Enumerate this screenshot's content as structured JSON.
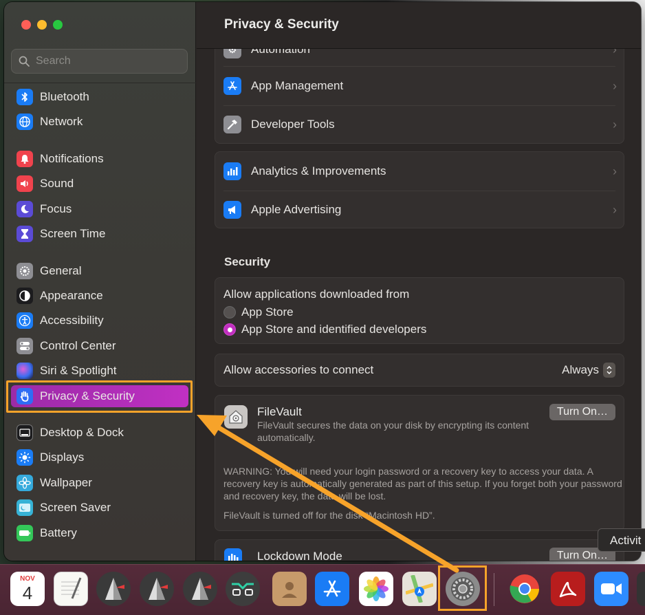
{
  "window": {
    "title": "Privacy & Security"
  },
  "search": {
    "placeholder": "Search"
  },
  "sidebar": {
    "items": [
      {
        "label": "Bluetooth",
        "icon": "bluetooth-icon",
        "color": "#1a7cf5"
      },
      {
        "label": "Network",
        "icon": "globe-icon",
        "color": "#1a7cf5"
      },
      {
        "label": "Notifications",
        "icon": "bell-icon",
        "color": "#f0434d"
      },
      {
        "label": "Sound",
        "icon": "speaker-icon",
        "color": "#f0434d"
      },
      {
        "label": "Focus",
        "icon": "moon-icon",
        "color": "#5b4bd6"
      },
      {
        "label": "Screen Time",
        "icon": "hourglass-icon",
        "color": "#5b4bd6"
      },
      {
        "label": "General",
        "icon": "gear-icon",
        "color": "#8e8e93"
      },
      {
        "label": "Appearance",
        "icon": "appearance-icon",
        "color": "#1c1c1e"
      },
      {
        "label": "Accessibility",
        "icon": "accessibility-icon",
        "color": "#1a7cf5"
      },
      {
        "label": "Control Center",
        "icon": "toggles-icon",
        "color": "#8e8e93"
      },
      {
        "label": "Siri & Spotlight",
        "icon": "siri-icon",
        "color": "#2c2c8c"
      },
      {
        "label": "Privacy & Security",
        "icon": "hand-icon",
        "color": "#2f6df5"
      },
      {
        "label": "Desktop & Dock",
        "icon": "dock-icon",
        "color": "#1c1c1e"
      },
      {
        "label": "Displays",
        "icon": "sun-icon",
        "color": "#1a7cf5"
      },
      {
        "label": "Wallpaper",
        "icon": "flower-icon",
        "color": "#35aadc"
      },
      {
        "label": "Screen Saver",
        "icon": "screensaver-icon",
        "color": "#37b3d6"
      },
      {
        "label": "Battery",
        "icon": "battery-icon",
        "color": "#34c759"
      }
    ]
  },
  "privacy": {
    "partial_row": "Automation",
    "group1": [
      {
        "label": "App Management",
        "icon": "appstore-icon",
        "color": "#1a7cf5"
      },
      {
        "label": "Developer Tools",
        "icon": "hammer-icon",
        "color": "#8e8e93"
      }
    ],
    "group2": [
      {
        "label": "Analytics & Improvements",
        "icon": "chart-icon",
        "color": "#1a7cf5"
      },
      {
        "label": "Apple Advertising",
        "icon": "megaphone-icon",
        "color": "#1a7cf5"
      }
    ]
  },
  "security": {
    "title": "Security",
    "allow_apps_label": "Allow applications downloaded from",
    "options": [
      "App Store",
      "App Store and identified developers"
    ],
    "selected_option": 1,
    "accessories_label": "Allow accessories to connect",
    "accessories_value": "Always",
    "filevault": {
      "title": "FileVault",
      "description": "FileVault secures the data on your disk by encrypting its content automatically.",
      "button": "Turn On…",
      "warning": "WARNING: You will need your login password or a recovery key to access your data. A recovery key is automatically generated as part of this setup. If you forget both your password and recovery key, the data will be lost.",
      "status": "FileVault is turned off for the disk “Macintosh HD”."
    },
    "lockdown": {
      "title": "Lockdown Mode",
      "button": "Turn On…"
    }
  },
  "tooltip": {
    "text": "Activit"
  },
  "dock": {
    "calendar_month": "NOV",
    "calendar_day": "4",
    "apps": [
      "calendar",
      "textedit",
      "grapher",
      "grapher",
      "grapher",
      "glasses-app",
      "contacts",
      "app-store",
      "photos",
      "maps",
      "system-settings",
      "chrome",
      "acrobat",
      "zoom"
    ]
  },
  "accent": "#f7a32a"
}
